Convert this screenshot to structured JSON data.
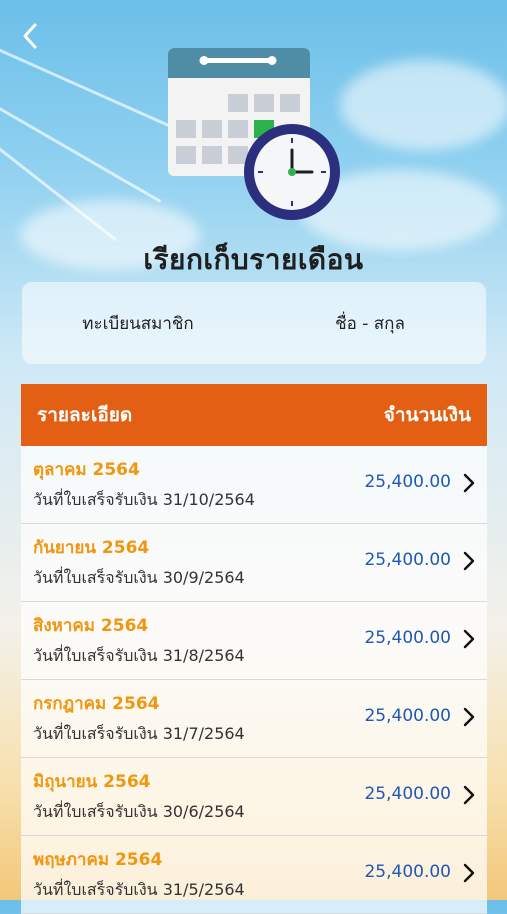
{
  "page": {
    "title": "เรียกเก็บรายเดือน"
  },
  "member": {
    "id_label": "ทะเบียนสมาชิก",
    "name_label": "ชื่อ - สกุล"
  },
  "table": {
    "header_detail": "รายละเอียด",
    "header_amount": "จำนวนเงิน",
    "rows": [
      {
        "month": "ตุลาคม 2564",
        "receipt": "วันที่ใบเสร็จรับเงิน 31/10/2564",
        "amount": "25,400.00"
      },
      {
        "month": "กันยายน 2564",
        "receipt": "วันที่ใบเสร็จรับเงิน 30/9/2564",
        "amount": "25,400.00"
      },
      {
        "month": "สิงหาคม 2564",
        "receipt": "วันที่ใบเสร็จรับเงิน 31/8/2564",
        "amount": "25,400.00"
      },
      {
        "month": "กรกฎาคม 2564",
        "receipt": "วันที่ใบเสร็จรับเงิน 31/7/2564",
        "amount": "25,400.00"
      },
      {
        "month": "มิถุนายน 2564",
        "receipt": "วันที่ใบเสร็จรับเงิน 30/6/2564",
        "amount": "25,400.00"
      },
      {
        "month": "พฤษภาคม 2564",
        "receipt": "วันที่ใบเสร็จรับเงิน 31/5/2564",
        "amount": "25,400.00"
      }
    ]
  },
  "colors": {
    "header_bg": "#e35f14",
    "month_text": "#f0960f",
    "amount_text": "#1f58b5"
  },
  "icons": {
    "back": "chevron-left-icon",
    "hero": "calendar-clock-icon",
    "row": "chevron-right-icon"
  }
}
